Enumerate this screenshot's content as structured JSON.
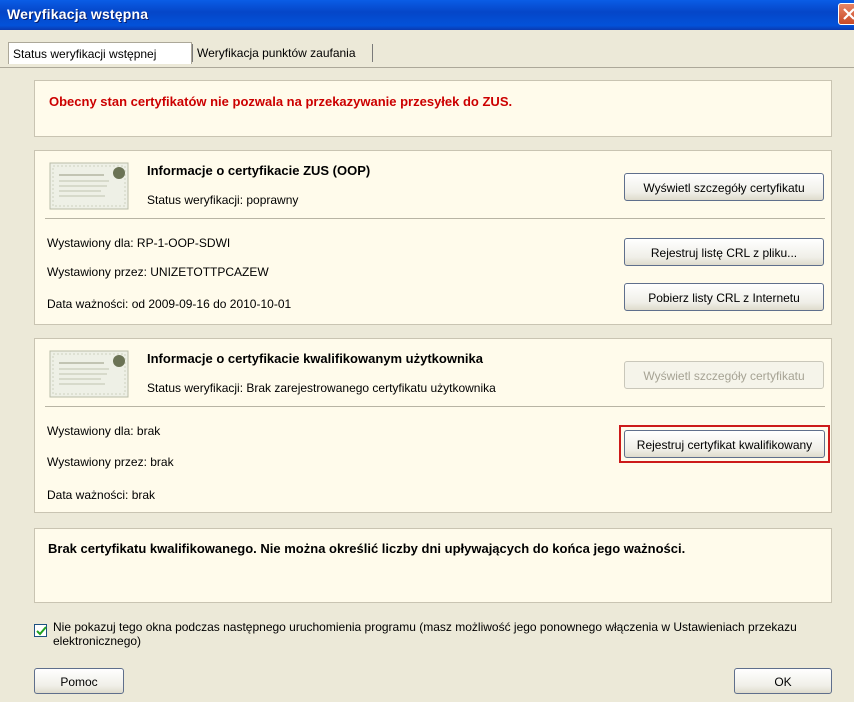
{
  "window": {
    "title": "Weryfikacja wstępna",
    "close_icon": "close-icon"
  },
  "tabs": [
    {
      "label": "Status weryfikacji wstępnej",
      "active": true
    },
    {
      "label": "Weryfikacja punktów zaufania",
      "active": false
    }
  ],
  "warning": {
    "text": "Obecny stan certyfikatów nie pozwala na przekazywanie przesyłek do ZUS.",
    "color": "#cc0000"
  },
  "zus_cert": {
    "icon": "certificate-icon",
    "title": "Informacje o certyfikacie ZUS (OOP)",
    "status": "Status weryfikacji: poprawny",
    "issued_for": "Wystawiony dla: RP-1-OOP-SDWI",
    "issued_by": "Wystawiony przez: UNIZETOTTPCAZEW",
    "validity": "Data ważności: od 2009-09-16 do 2010-10-01",
    "btn_details": "Wyświetl szczegóły certyfikatu",
    "btn_register_crl": "Rejestruj listę CRL z pliku...",
    "btn_download_crl": "Pobierz listy CRL z Internetu"
  },
  "user_cert": {
    "icon": "certificate-icon",
    "title": "Informacje o certyfikacie kwalifikowanym użytkownika",
    "status": "Status weryfikacji: Brak zarejestrowanego certyfikatu użytkownika",
    "issued_for": "Wystawiony dla: brak",
    "issued_by": "Wystawiony przez: brak",
    "validity": "Data ważności: brak",
    "btn_details": "Wyświetl szczegóły certyfikatu",
    "btn_details_disabled": true,
    "btn_register": "Rejestruj certyfikat kwalifikowany",
    "highlight_color": "#cc1a1a"
  },
  "info": {
    "text": "Brak certyfikatu kwalifikowanego. Nie można określić liczby dni upływających do końca jego ważności."
  },
  "checkbox": {
    "checked": true,
    "label": "Nie pokazuj tego okna podczas następnego uruchomienia programu (masz możliwość jego ponownego włączenia w Ustawieniach przekazu elektronicznego)"
  },
  "buttons": {
    "help": "Pomoc",
    "ok": "OK"
  },
  "colors": {
    "titlebar": "#0352d9",
    "dialog_bg": "#ece9d8",
    "panel_bg": "#fffbeb"
  }
}
